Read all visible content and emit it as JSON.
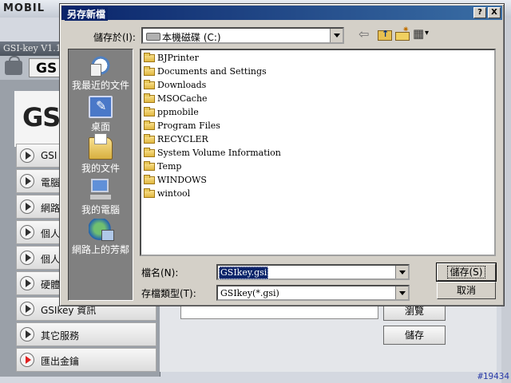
{
  "background": {
    "brand": "MOBIL",
    "app_title": "GSI-key V1.1",
    "lock_label": "GS",
    "logo_text": "GS",
    "menu_items": [
      "GSI",
      "電腦",
      "網路",
      "個人",
      "個人",
      "硬體",
      "GSIkey 資訊",
      "其它服務",
      "匯出金鑰"
    ],
    "browse_button": "瀏覽",
    "save_button": "儲存",
    "watermark": "#19434"
  },
  "dialog": {
    "title": "另存新檔",
    "help_button": "?",
    "close_button": "X",
    "save_in_label": "儲存於(I):",
    "save_in_value": "本機磁碟 (C:)",
    "places": [
      {
        "label": "我最近的文件",
        "icon": "recent-documents-icon"
      },
      {
        "label": "桌面",
        "icon": "desktop-icon"
      },
      {
        "label": "我的文件",
        "icon": "my-documents-icon"
      },
      {
        "label": "我的電腦",
        "icon": "my-computer-icon"
      },
      {
        "label": "網路上的芳鄰",
        "icon": "network-places-icon"
      }
    ],
    "folders": [
      "BJPrinter",
      "Documents and Settings",
      "Downloads",
      "MSOCache",
      "ppmobile",
      "Program Files",
      "RECYCLER",
      "System Volume Information",
      "Temp",
      "WINDOWS",
      "wintool"
    ],
    "filename_label": "檔名(N):",
    "filename_value": "GSIkey.gsi",
    "filetype_label": "存檔類型(T):",
    "filetype_value": "GSIkey(*.gsi)",
    "save_button": "儲存(S)",
    "cancel_button": "取消"
  },
  "colors": {
    "title_bar": "#0a246a",
    "dialog_face": "#d4d0c8",
    "places_bar": "#808080"
  }
}
